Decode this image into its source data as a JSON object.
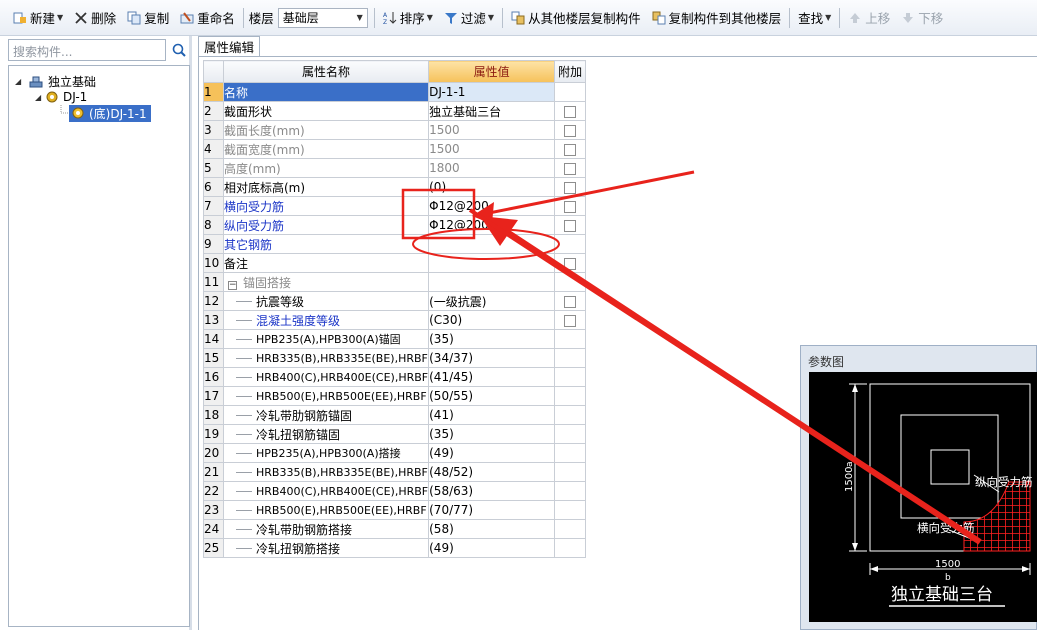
{
  "toolbar": {
    "new_label": "新建",
    "delete_label": "删除",
    "copy_label": "复制",
    "rename_label": "重命名",
    "floor_label": "楼层",
    "floor_value": "基础层",
    "sort_label": "排序",
    "filter_label": "过滤",
    "copy_from_label": "从其他楼层复制构件",
    "copy_to_label": "复制构件到其他楼层",
    "find_label": "查找",
    "up_label": "上移",
    "down_label": "下移"
  },
  "left_panel": {
    "search_placeholder": "搜索构件...",
    "tree": [
      {
        "label": "独立基础"
      },
      {
        "label": "DJ-1"
      },
      {
        "label": "(底)DJ-1-1"
      }
    ]
  },
  "tab": {
    "label": "属性编辑"
  },
  "grid": {
    "headers": {
      "name": "属性名称",
      "value": "属性值",
      "extra": "附加"
    },
    "rows": [
      {
        "num": "1",
        "name": "名称",
        "value": "DJ-1-1"
      },
      {
        "num": "2",
        "name": "截面形状",
        "value": "独立基础三台"
      },
      {
        "num": "3",
        "name": "截面长度(mm)",
        "value": "1500"
      },
      {
        "num": "4",
        "name": "截面宽度(mm)",
        "value": "1500"
      },
      {
        "num": "5",
        "name": "高度(mm)",
        "value": "1800"
      },
      {
        "num": "6",
        "name": "相对底标高(m)",
        "value": "(0)"
      },
      {
        "num": "7",
        "name": "横向受力筋",
        "value": "Φ12@200"
      },
      {
        "num": "8",
        "name": "纵向受力筋",
        "value": "Φ12@200"
      },
      {
        "num": "9",
        "name": "其它钢筋",
        "value": ""
      },
      {
        "num": "10",
        "name": "备注",
        "value": ""
      },
      {
        "num": "11",
        "name": "锚固搭接",
        "value": ""
      },
      {
        "num": "12",
        "name": "抗震等级",
        "value": "(一级抗震)"
      },
      {
        "num": "13",
        "name": "混凝土强度等级",
        "value": "(C30)"
      },
      {
        "num": "14",
        "name": "HPB235(A),HPB300(A)锚固",
        "value": "(35)"
      },
      {
        "num": "15",
        "name": "HRB335(B),HRB335E(BE),HRBF",
        "value": "(34/37)"
      },
      {
        "num": "16",
        "name": "HRB400(C),HRB400E(CE),HRBF",
        "value": "(41/45)"
      },
      {
        "num": "17",
        "name": "HRB500(E),HRB500E(EE),HRBF",
        "value": "(50/55)"
      },
      {
        "num": "18",
        "name": "冷轧带肋钢筋锚固",
        "value": "(41)"
      },
      {
        "num": "19",
        "name": "冷轧扭钢筋锚固",
        "value": "(35)"
      },
      {
        "num": "20",
        "name": "HPB235(A),HPB300(A)搭接",
        "value": "(49)"
      },
      {
        "num": "21",
        "name": "HRB335(B),HRB335E(BE),HRBF",
        "value": "(48/52)"
      },
      {
        "num": "22",
        "name": "HRB400(C),HRB400E(CE),HRBF",
        "value": "(58/63)"
      },
      {
        "num": "23",
        "name": "HRB500(E),HRB500E(EE),HRBF",
        "value": "(70/77)"
      },
      {
        "num": "24",
        "name": "冷轧带肋钢筋搭接",
        "value": "(58)"
      },
      {
        "num": "25",
        "name": "冷轧扭钢筋搭接",
        "value": "(49)"
      }
    ]
  },
  "param_window": {
    "title": "参数图",
    "diagram": {
      "dim_b": "1500",
      "b_label": "b",
      "dim_h": "1500",
      "long_label": "纵向受力筋",
      "trans_label": "横向受力筋",
      "caption": "独立基础三台"
    }
  },
  "colors": {
    "selection_blue": "#3a6fc8",
    "value_header": "#f6c15a",
    "link_blue": "#1b35c7",
    "annotation_red": "#e8231c"
  }
}
